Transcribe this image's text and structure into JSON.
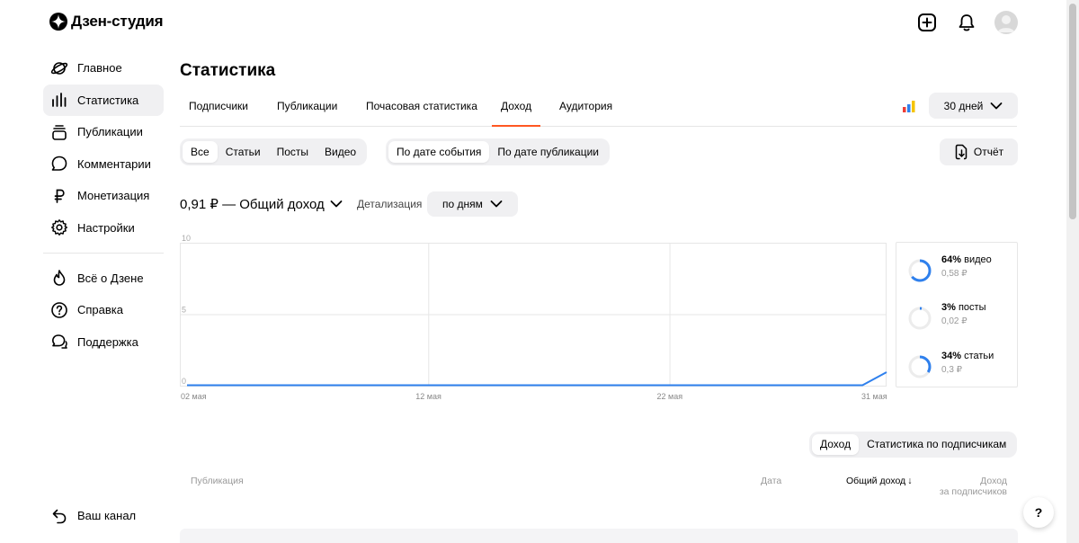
{
  "app": {
    "title": "Дзен-студия"
  },
  "sidebar": {
    "items": [
      {
        "label": "Главное",
        "icon": "planet-icon"
      },
      {
        "label": "Статистика",
        "icon": "bar-chart-icon",
        "active": true
      },
      {
        "label": "Публикации",
        "icon": "stack-icon"
      },
      {
        "label": "Комментарии",
        "icon": "comment-icon"
      },
      {
        "label": "Монетизация",
        "icon": "ruble-icon"
      },
      {
        "label": "Настройки",
        "icon": "gear-icon"
      }
    ],
    "secondary": [
      {
        "label": "Всё о Дзене",
        "icon": "flame-icon"
      },
      {
        "label": "Справка",
        "icon": "question-icon"
      },
      {
        "label": "Поддержка",
        "icon": "chat-icon"
      }
    ],
    "bottom": {
      "label": "Ваш канал",
      "icon": "back-arrow-icon"
    }
  },
  "page": {
    "title": "Статистика"
  },
  "tabs": [
    {
      "label": "Подписчики"
    },
    {
      "label": "Публикации"
    },
    {
      "label": "Почасовая статистика"
    },
    {
      "label": "Доход",
      "active": true
    },
    {
      "label": "Аудитория"
    }
  ],
  "period": {
    "label": "30 дней"
  },
  "content_filter": {
    "items": [
      "Все",
      "Статьи",
      "Посты",
      "Видео"
    ],
    "active": "Все"
  },
  "date_filter": {
    "items": [
      "По дате события",
      "По дате публикации"
    ],
    "active": "По дате события"
  },
  "report": {
    "label": "Отчёт"
  },
  "summary": {
    "label": "0,91 ₽ — Общий доход"
  },
  "detail": {
    "label": "Детализация",
    "value": "по дням"
  },
  "chart_data": {
    "type": "line",
    "x_labels": [
      "02 мая",
      "12 мая",
      "22 мая",
      "31 мая"
    ],
    "y_ticks": [
      "10",
      "5",
      "0"
    ],
    "ylim": [
      0,
      10
    ],
    "series": [
      {
        "values": [
          0,
          0,
          0,
          0,
          0,
          0,
          0,
          0,
          0,
          0,
          0,
          0,
          0,
          0,
          0,
          0,
          0,
          0,
          0,
          0,
          0,
          0,
          0,
          0,
          0,
          0,
          0,
          0,
          0,
          0.91
        ],
        "color": "#2f80ed"
      }
    ],
    "grid": true
  },
  "shares": [
    {
      "pct": "64%",
      "label": "видео",
      "sum": "0,58 ₽",
      "value": 0.64
    },
    {
      "pct": "3%",
      "label": "посты",
      "sum": "0,02 ₽",
      "value": 0.03
    },
    {
      "pct": "34%",
      "label": "статьи",
      "sum": "0,3 ₽",
      "value": 0.34
    }
  ],
  "table_toggle": {
    "items": [
      "Доход",
      "Статистика по подписчикам"
    ],
    "active": "Доход"
  },
  "table": {
    "headers": {
      "publication": "Публикация",
      "date": "Дата",
      "total": "Общий доход",
      "sort_arrow": "↓",
      "subs_1": "Доход",
      "subs_2": "за подписчиков"
    }
  },
  "help": {
    "label": "?"
  },
  "colors": {
    "accent": "#ff5722",
    "line": "#2f80ed",
    "muted": "#999999",
    "chip": "#f0f0f2"
  }
}
